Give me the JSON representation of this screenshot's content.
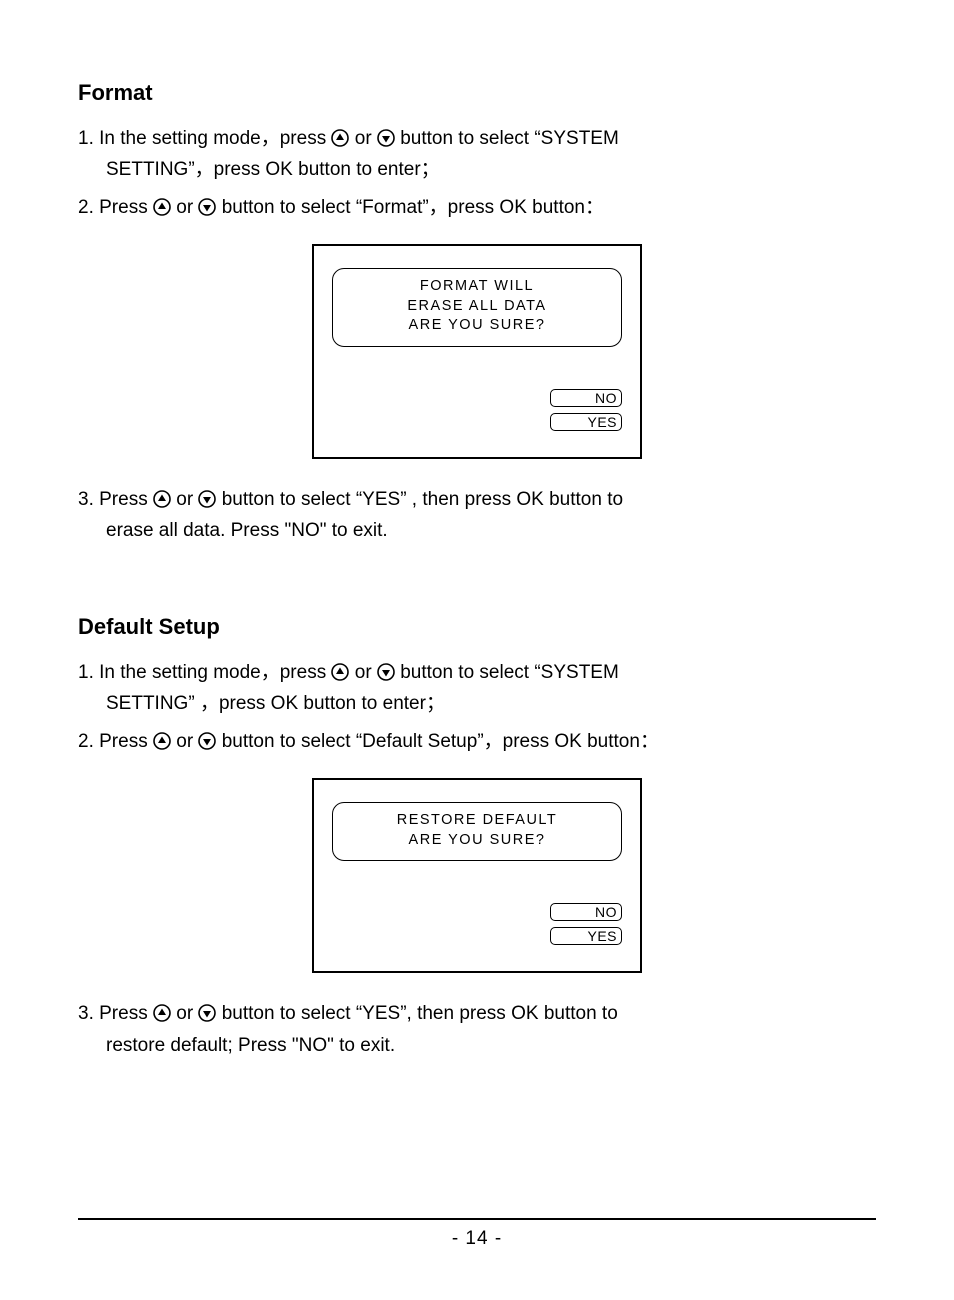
{
  "format": {
    "heading": "Format",
    "step1_a": "1. In the setting mode，press ",
    "step1_b": " or ",
    "step1_c": " button to select “SYSTEM",
    "step1_line2": "SETTING”，press OK button to enter；",
    "step2_a": "2. Press ",
    "step2_b": " or ",
    "step2_c": " button to select “Format”，press OK button：",
    "step3_a": "3. Press ",
    "step3_b": " or ",
    "step3_c": " button to select “YES” , then press OK button to",
    "step3_line2": "erase all data.  Press \"NO\" to exit.",
    "dialog": {
      "line1": "FORMAT WILL",
      "line2": "ERASE ALL DATA",
      "line3": "ARE YOU SURE?",
      "no": "NO",
      "yes": "YES"
    }
  },
  "default_setup": {
    "heading": "Default Setup",
    "step1_a": "1. In the setting mode，press ",
    "step1_b": " or ",
    "step1_c": " button to select “SYSTEM",
    "step1_line2": "SETTING” ，press OK button to enter；",
    "step2_a": "2. Press ",
    "step2_b": " or ",
    "step2_c": " button to select  “Default Setup”，press OK button：",
    "step3_a": "3. Press ",
    "step3_b": " or ",
    "step3_c": " button to select “YES”, then press OK button to",
    "step3_line2": "restore default; Press \"NO\" to exit.",
    "dialog": {
      "line1": "RESTORE DEFAULT",
      "line2": "ARE YOU SURE?",
      "no": "NO",
      "yes": "YES"
    }
  },
  "page_number": "- 14 -"
}
